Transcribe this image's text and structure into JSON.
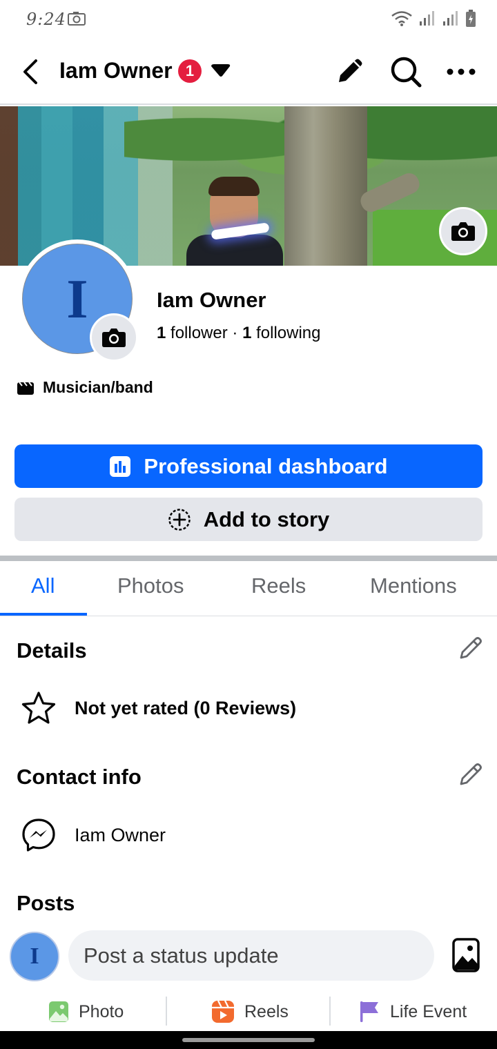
{
  "status_bar": {
    "time": "9:24"
  },
  "header": {
    "title": "Iam Owner",
    "notification_count": "1"
  },
  "profile": {
    "name": "Iam Owner",
    "avatar_initial": "I",
    "followers_count": "1",
    "followers_label": "follower",
    "separator": "·",
    "following_count": "1",
    "following_label": "following",
    "category": "Musician/band"
  },
  "buttons": {
    "dashboard": "Professional dashboard",
    "story": "Add to story"
  },
  "tabs": [
    "All",
    "Photos",
    "Reels",
    "Mentions"
  ],
  "details": {
    "title": "Details",
    "rating": "Not yet rated (0 Reviews)"
  },
  "contact": {
    "title": "Contact info",
    "messenger_name": "Iam Owner"
  },
  "posts": {
    "title": "Posts",
    "placeholder": "Post a status update",
    "actions": [
      "Photo",
      "Reels",
      "Life Event"
    ]
  },
  "colors": {
    "primary": "#0866ff",
    "badge": "#e41e3f",
    "avatar": "#5b97e6",
    "secondary_button": "#e4e6eb"
  }
}
